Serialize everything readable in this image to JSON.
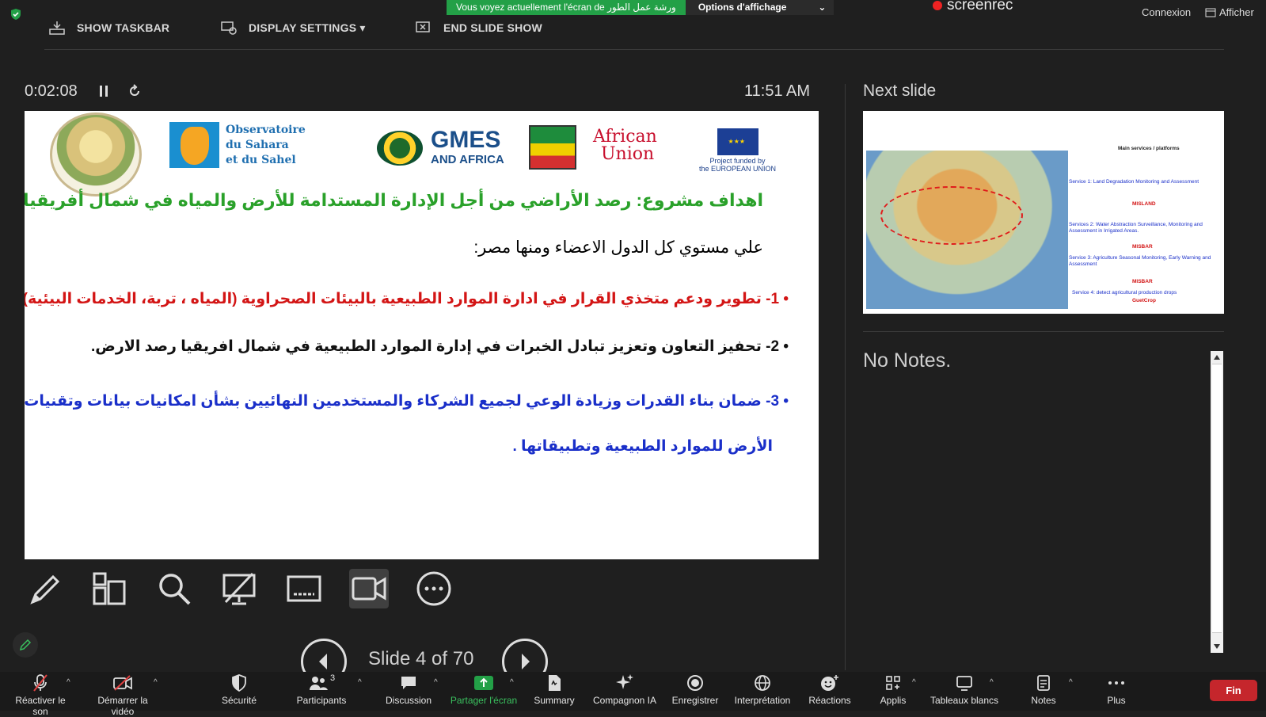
{
  "banner": {
    "message": "Vous voyez actuellement l'écran de ورشة عمل الطور",
    "options_label": "Options d'affichage",
    "options_caret": "⌄"
  },
  "screenrec_label": "screenrec",
  "top_right": {
    "connexion": "Connexion",
    "afficher": "Afficher"
  },
  "presenter_toolbar": {
    "show_taskbar": "SHOW TASKBAR",
    "display_settings": "DISPLAY SETTINGS ▾",
    "end_slide_show": "END SLIDE SHOW"
  },
  "timer": "0:02:08",
  "clock": "11:51 AM",
  "slide": {
    "logos": {
      "oss_line1": "Observatoire",
      "oss_line2": "du Sahara",
      "oss_line3": "et du Sahel",
      "gmes_big": "GMES",
      "gmes_small": "AND AFRICA",
      "au_line1": "African",
      "au_line2": "Union",
      "eu_caption1": "Project funded by",
      "eu_caption2": "the EUROPEAN UNION"
    },
    "heading": "اهداف مشروع: رصد الأراضي من أجل الإدارة المستدامة للأرض والمياه في شمال أفريقيا.",
    "subheading": "علي مستوي كل الدول الاعضاء ومنها مصر:",
    "bullet1": "• 1- تطوير ودعم متخذي القرار في ادارة الموارد الطبيعية بالبيئات الصحراوية (المياه ، تربة، الخدمات البيئية).",
    "bullet2": "• 2- تحفيز التعاون وتعزيز تبادل الخبرات في إدارة الموارد الطبيعية في شمال افريقيا رصد الارض.",
    "bullet3": "• 3- ضمان بناء القدرات وزيادة الوعي لجميع الشركاء والمستخدمين النهائيين بشأن امكانيات بيانات وتقنيات رصد",
    "bullet3_cont": "الأرض للموارد الطبيعية وتطبيقاتها ."
  },
  "next_slide": {
    "label": "Next slide",
    "thumb_title": "Main services / platforms",
    "service1": "Service 1: Land Degradation Monitoring and Assessment",
    "service1_tag": "MISLAND",
    "service2": "Services 2: Water Abstraction Surveillance, Monitoring and Assessment in Irrigated Areas.",
    "service2_tag": "MISBAR",
    "service3": "Service 3: Agriculture Seasonal Monitoring, Early Warning and Assessment",
    "service3_tag": "MISBAR",
    "service4": "Service 4: detect agricultural production drops",
    "service4_tag": "GuetCrop"
  },
  "notes": "No Notes.",
  "slide_counter": "Slide 4 of 70",
  "bottom_bar": {
    "mute": "Réactiver le son",
    "video": "Démarrer la vidéo",
    "security": "Sécurité",
    "participants": "Participants",
    "participants_count": "3",
    "chat": "Discussion",
    "share": "Partager l'écran",
    "summary": "Summary",
    "ai": "Compagnon IA",
    "record": "Enregistrer",
    "interpretation": "Interprétation",
    "reactions": "Réactions",
    "apps": "Applis",
    "whiteboards": "Tableaux blancs",
    "notes": "Notes",
    "more": "Plus",
    "end": "Fin"
  },
  "colors": {
    "share_green": "#23a047",
    "end_red": "#c5262c",
    "bg": "#1f1f1f"
  }
}
